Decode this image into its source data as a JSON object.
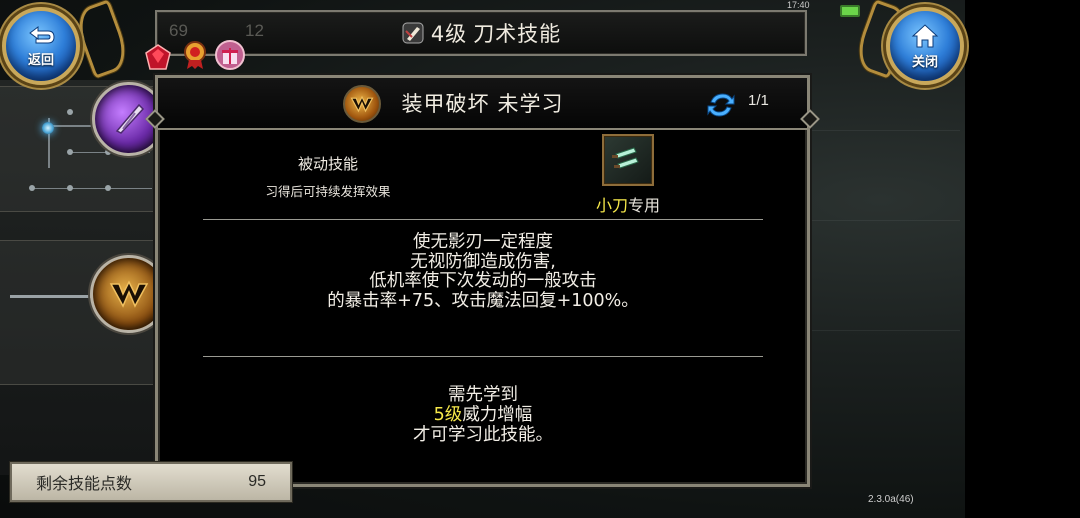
{
  "status_bar": {
    "time": "17:40"
  },
  "nav": {
    "back_label": "返回",
    "close_label": "关闭"
  },
  "topbar": {
    "level_prefix": "4级",
    "title": "刀术技能",
    "ghost_left": "69",
    "ghost_right": "12"
  },
  "skill": {
    "name": "装甲破坏",
    "status": "未学习",
    "page": "1/1",
    "type_label": "被动技能",
    "type_desc": "习得后可持续发挥效果",
    "weapon_highlight": "小刀",
    "weapon_suffix": "专用",
    "effect_lines": [
      "使无影刃一定程度",
      "无视防御造成伤害,",
      "低机率使下次发动的一般攻击",
      "的暴击率+75、攻击魔法回复+100%。"
    ],
    "prereq_line1": "需先学到",
    "prereq_level": "5级",
    "prereq_skill": "威力增幅",
    "prereq_line3": "才可学习此技能。"
  },
  "skill_points": {
    "label": "剩余技能点数",
    "value": "95"
  },
  "version": "2.3.0a(46)",
  "icons": {
    "back": "return-arrow-icon",
    "close": "home-icon",
    "title": "blade-icon",
    "skill": "armor-break-icon",
    "refresh": "refresh-icon",
    "weapon": "dagger-icon",
    "gems": [
      "ruby-icon",
      "medal-icon",
      "gift-icon"
    ]
  },
  "colors": {
    "highlight": "#f7e94a",
    "button_blue": "#2f7fd9",
    "frame": "#8a8677"
  }
}
